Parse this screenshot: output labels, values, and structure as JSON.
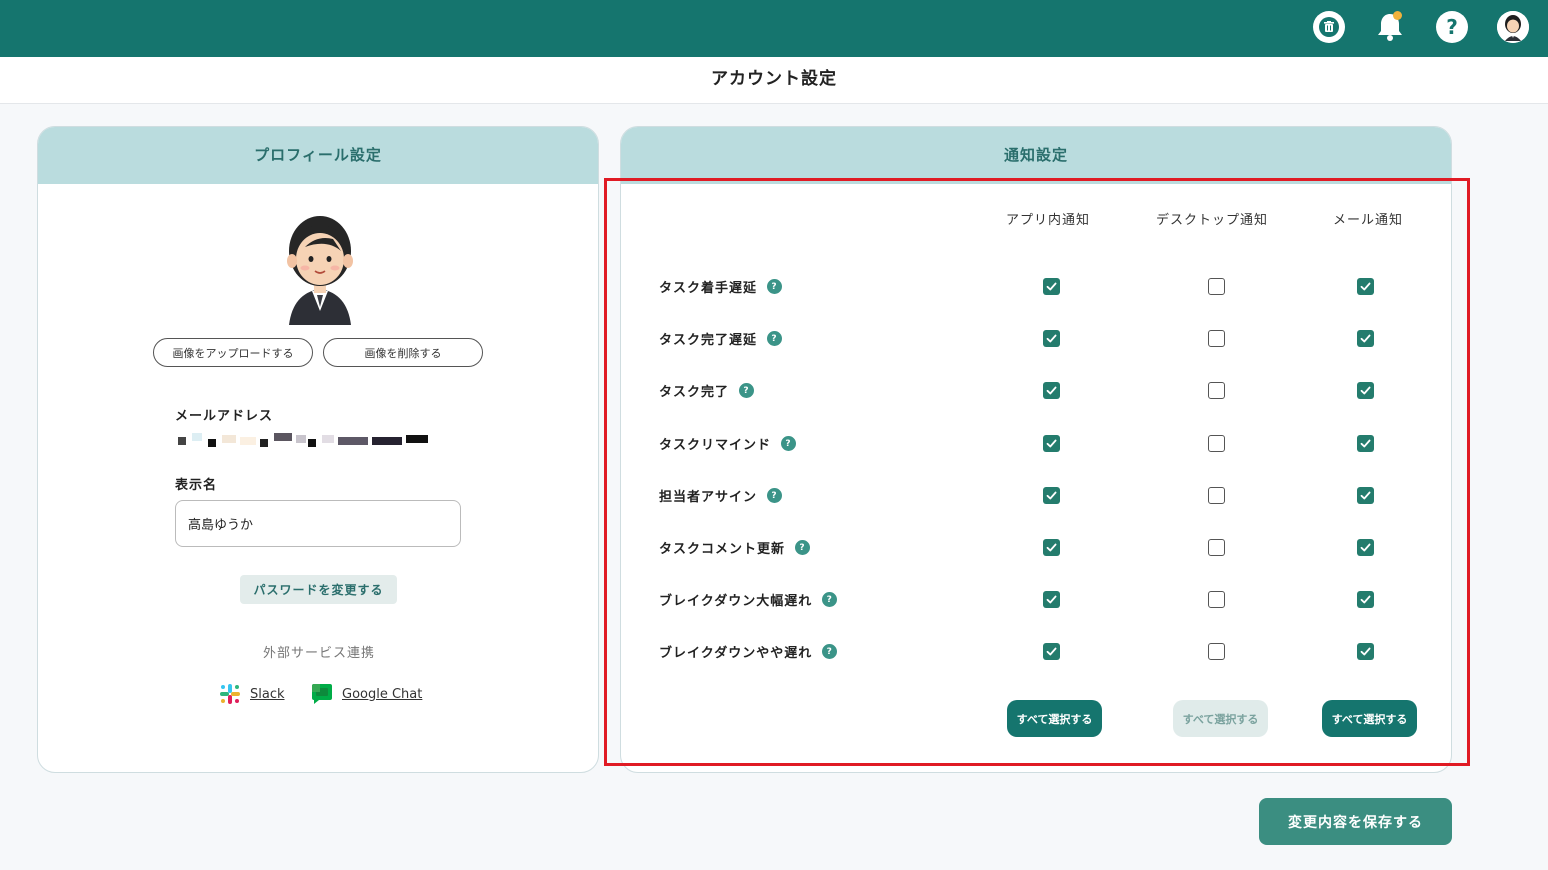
{
  "page_title": "アカウント設定",
  "profile": {
    "header": "プロフィール設定",
    "upload_label": "画像をアップロードする",
    "delete_label": "画像を削除する",
    "email_label": "メールアドレス",
    "display_name_label": "表示名",
    "display_name_value": "高島ゆうか",
    "password_label": "パスワードを変更する",
    "external_title": "外部サービス連携",
    "slack_label": "Slack",
    "gchat_label": "Google Chat"
  },
  "notification": {
    "header": "通知設定",
    "columns": [
      "アプリ内通知",
      "デスクトップ通知",
      "メール通知"
    ],
    "rows": [
      {
        "label": "タスク着手遅延",
        "values": [
          true,
          false,
          true
        ]
      },
      {
        "label": "タスク完了遅延",
        "values": [
          true,
          false,
          true
        ]
      },
      {
        "label": "タスク完了",
        "values": [
          true,
          false,
          true
        ]
      },
      {
        "label": "タスクリマインド",
        "values": [
          true,
          false,
          true
        ]
      },
      {
        "label": "担当者アサイン",
        "values": [
          true,
          false,
          true
        ]
      },
      {
        "label": "タスクコメント更新",
        "values": [
          true,
          false,
          true
        ]
      },
      {
        "label": "ブレイクダウン大幅遅れ",
        "values": [
          true,
          false,
          true
        ]
      },
      {
        "label": "ブレイクダウンやや遅れ",
        "values": [
          true,
          false,
          true
        ]
      }
    ],
    "select_all_label": "すべて選択する",
    "help_mark": "?"
  },
  "save_label": "変更内容を保存する",
  "icons": {
    "trash": "trash-icon",
    "bell": "bell-icon",
    "help": "help-icon",
    "help_glyph": "?",
    "avatar": "avatar"
  },
  "colors": {
    "brand": "#15756e",
    "card_header": "#badcde",
    "checkbox_on": "#247c6d",
    "notification_dot": "#f0b23c",
    "highlight": "#e01b24"
  }
}
